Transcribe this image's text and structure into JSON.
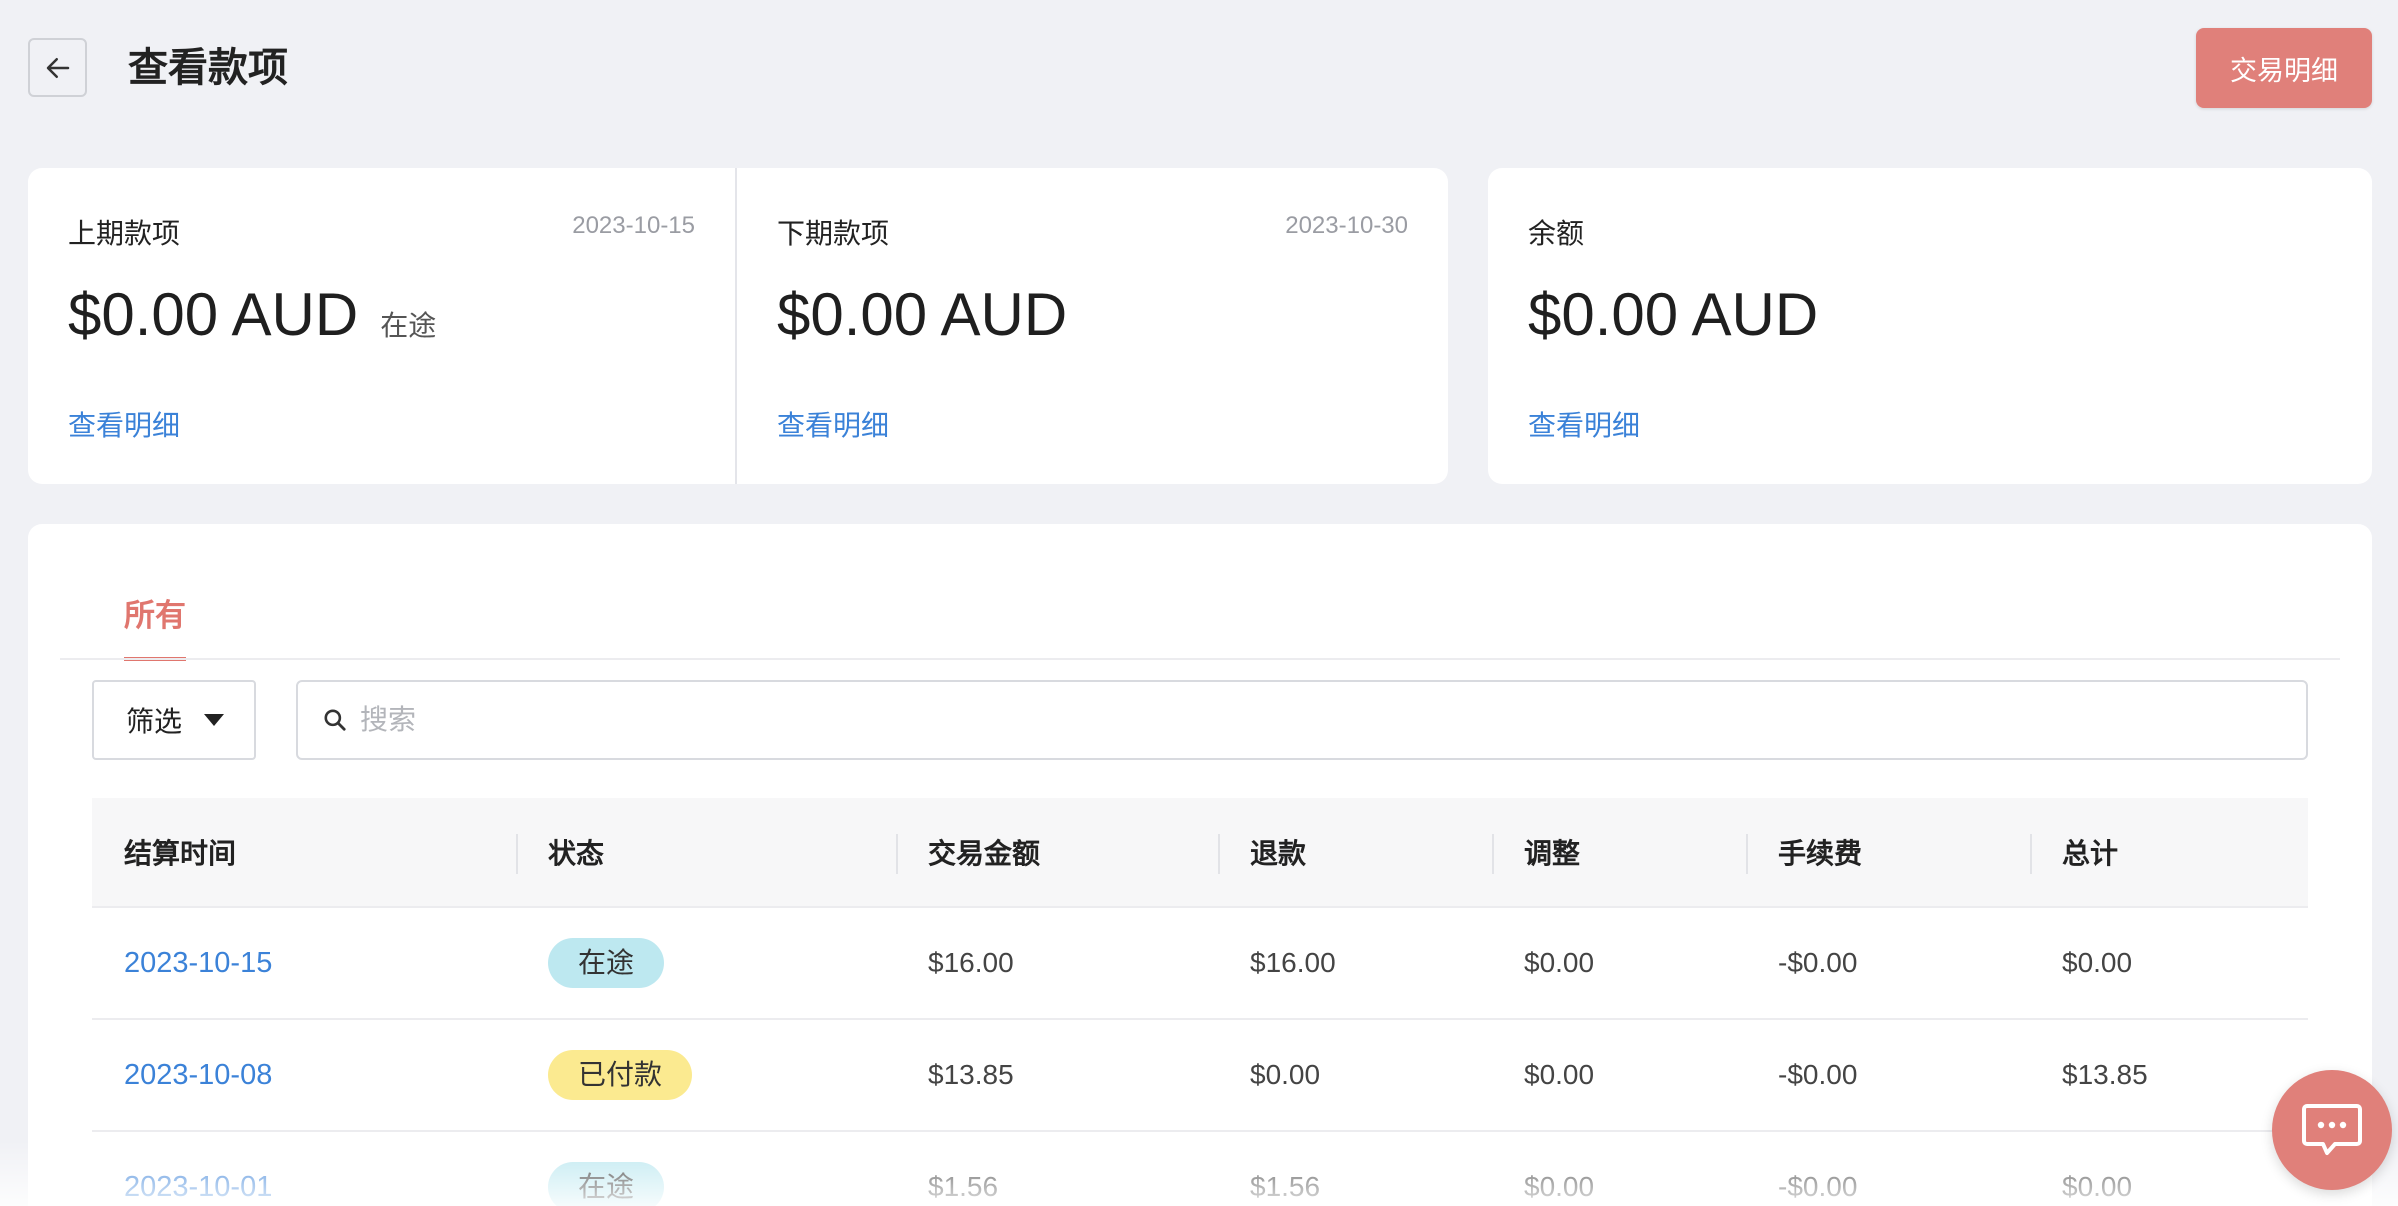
{
  "header": {
    "title": "查看款项",
    "transactions_button": "交易明细"
  },
  "cards": [
    {
      "label": "上期款项",
      "date": "2023-10-15",
      "amount": "$0.00 AUD",
      "sub": "在途",
      "link": "查看明细"
    },
    {
      "label": "下期款项",
      "date": "2023-10-30",
      "amount": "$0.00 AUD",
      "sub": "",
      "link": "查看明细"
    },
    {
      "label": "余额",
      "date": "",
      "amount": "$0.00 AUD",
      "sub": "",
      "link": "查看明细"
    }
  ],
  "tabs": [
    {
      "label": "所有",
      "active": true
    }
  ],
  "filter": {
    "label": "筛选"
  },
  "search": {
    "placeholder": "搜索",
    "value": ""
  },
  "table": {
    "columns": [
      "结算时间",
      "状态",
      "交易金额",
      "退款",
      "调整",
      "手续费",
      "总计"
    ],
    "rows": [
      {
        "date": "2023-10-15",
        "status": "在途",
        "status_type": "transit",
        "amount": "$16.00",
        "refund": "$16.00",
        "adjust": "$0.00",
        "fee": "-$0.00",
        "total": "$0.00"
      },
      {
        "date": "2023-10-08",
        "status": "已付款",
        "status_type": "paid",
        "amount": "$13.85",
        "refund": "$0.00",
        "adjust": "$0.00",
        "fee": "-$0.00",
        "total": "$13.85"
      },
      {
        "date": "2023-10-01",
        "status": "在途",
        "status_type": "transit",
        "amount": "$1.56",
        "refund": "$1.56",
        "adjust": "$0.00",
        "fee": "-$0.00",
        "total": "$0.00"
      }
    ]
  },
  "colors": {
    "accent": "#e0807a",
    "link": "#3b82d8",
    "badge_transit": "#bde8f0",
    "badge_paid": "#fbea90"
  },
  "icons": [
    "arrow-left-icon",
    "search-icon",
    "caret-down-icon",
    "chat-icon"
  ]
}
